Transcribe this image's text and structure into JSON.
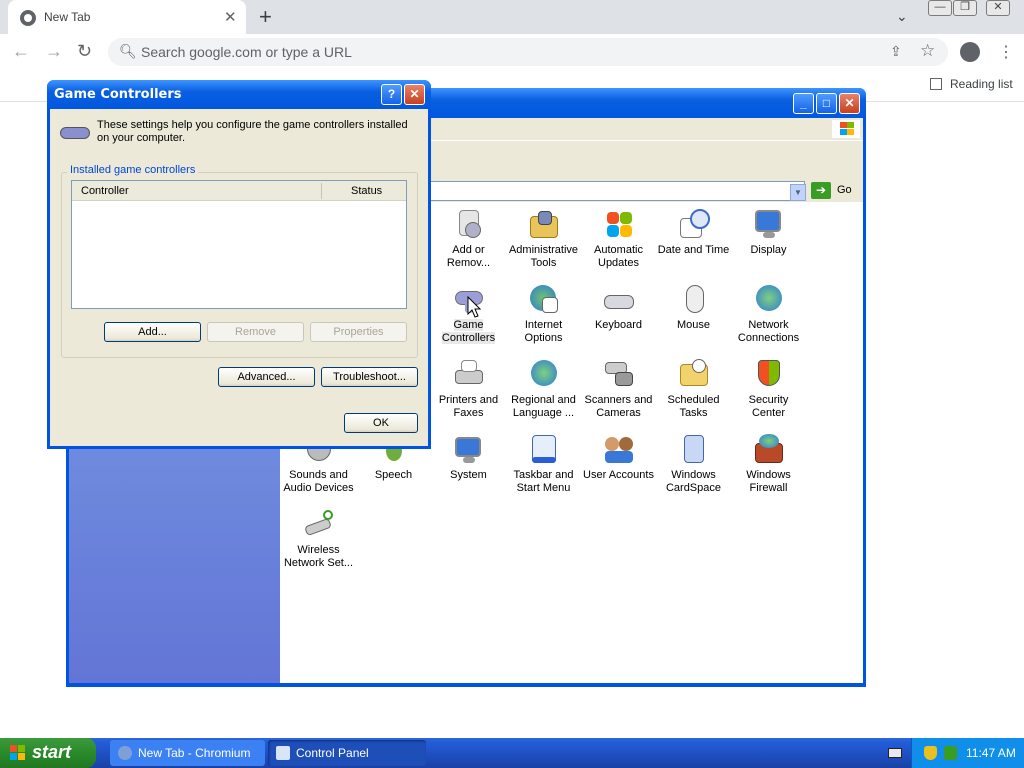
{
  "browser": {
    "tab_title": "New Tab",
    "omnibox_placeholder": "Search google.com or type a URL",
    "reading_list": "Reading list",
    "icons": [
      "back-icon",
      "forward-icon",
      "reload-icon",
      "search-icon",
      "share-icon",
      "star-icon",
      "profile-icon",
      "menu-icon",
      "close-icon",
      "plus-icon"
    ]
  },
  "control_panel": {
    "go_label": "Go",
    "items": [
      {
        "label": "Add or Remov...",
        "icon": "add-remove-icon"
      },
      {
        "label": "Administrative Tools",
        "icon": "admin-tools-icon"
      },
      {
        "label": "Automatic Updates",
        "icon": "updates-icon"
      },
      {
        "label": "Date and Time",
        "icon": "clock-icon"
      },
      {
        "label": "Display",
        "icon": "display-icon"
      },
      {
        "label": "Game Controllers",
        "icon": "gamepad-icon"
      },
      {
        "label": "Internet Options",
        "icon": "globe-icon"
      },
      {
        "label": "Keyboard",
        "icon": "keyboard-icon"
      },
      {
        "label": "Mouse",
        "icon": "mouse-icon"
      },
      {
        "label": "Network Connections",
        "icon": "network-icon"
      },
      {
        "label": "Printers and Faxes",
        "icon": "printer-icon"
      },
      {
        "label": "Regional and Language ...",
        "icon": "globe-icon"
      },
      {
        "label": "Scanners and Cameras",
        "icon": "scanner-icon"
      },
      {
        "label": "Scheduled Tasks",
        "icon": "folder-clock-icon"
      },
      {
        "label": "Security Center",
        "icon": "shield-icon"
      },
      {
        "label": "Sounds and Audio Devices",
        "icon": "speaker-icon"
      },
      {
        "label": "Speech",
        "icon": "speech-icon"
      },
      {
        "label": "System",
        "icon": "system-icon"
      },
      {
        "label": "Taskbar and Start Menu",
        "icon": "taskbar-icon"
      },
      {
        "label": "User Accounts",
        "icon": "users-icon"
      },
      {
        "label": "Windows CardSpace",
        "icon": "cardspace-icon"
      },
      {
        "label": "Windows Firewall",
        "icon": "firewall-icon"
      },
      {
        "label": "Wireless Network Set...",
        "icon": "wireless-icon"
      }
    ]
  },
  "dialog": {
    "title": "Game Controllers",
    "intro": "These settings help you configure the game controllers installed on your computer.",
    "group_label": "Installed game controllers",
    "col_controller": "Controller",
    "col_status": "Status",
    "add": "Add...",
    "remove": "Remove",
    "properties": "Properties",
    "advanced": "Advanced...",
    "troubleshoot": "Troubleshoot...",
    "ok": "OK"
  },
  "taskbar": {
    "start": "start",
    "task1": "New Tab - Chromium",
    "task2": "Control Panel",
    "clock": "11:47 AM"
  }
}
